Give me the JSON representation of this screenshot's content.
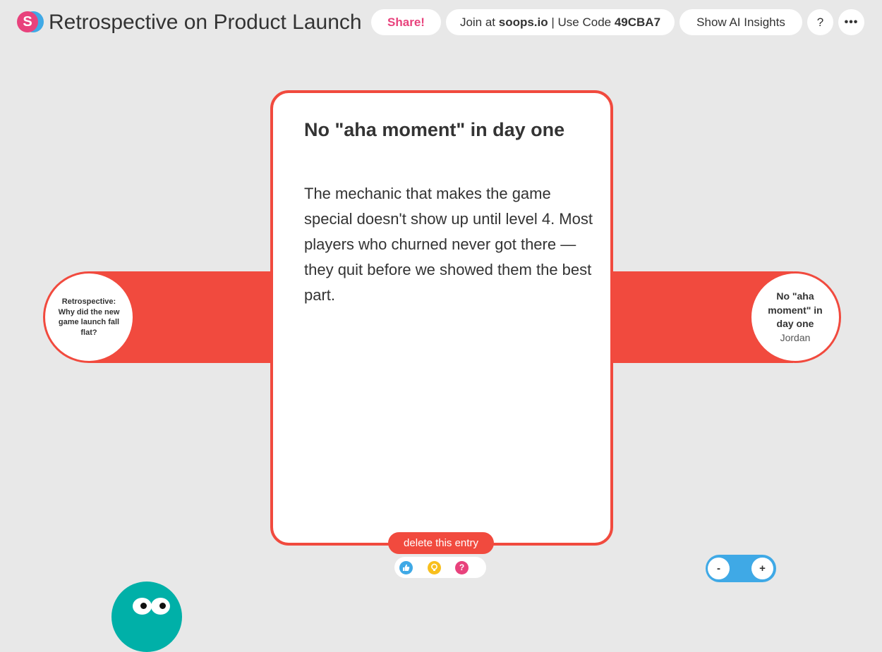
{
  "app": {
    "logo_letter": "S",
    "title": "Retrospective on Product Launch"
  },
  "header": {
    "share_label": "Share!",
    "join_prefix": "Join at ",
    "join_site": "soops.io",
    "join_middle": " | Use Code ",
    "join_code": "49CBA7",
    "insights_label": "Show AI Insights",
    "help_label": "?",
    "more_label": "•••"
  },
  "left_node": {
    "text": "Retrospective: Why did the new game launch fall flat?"
  },
  "right_node": {
    "title": "No \"aha moment\" in day one",
    "author": "Jordan"
  },
  "card": {
    "title": "No \"aha moment\" in day one",
    "body": "The mechanic that makes the game special doesn't show up until level 4. Most players who churned never got there — they quit before we showed them the best part."
  },
  "actions": {
    "delete_label": "delete this entry",
    "reactions": [
      {
        "icon": "thumbs-up-icon",
        "glyph": "👍",
        "color": "#3fa9e6"
      },
      {
        "icon": "lightbulb-icon",
        "glyph": "💡",
        "color": "#f8bf1d"
      },
      {
        "icon": "question-icon",
        "glyph": "?",
        "color": "#e8427c"
      }
    ]
  },
  "zoom": {
    "out_label": "-",
    "in_label": "+"
  },
  "colors": {
    "accent_red": "#f14a3e",
    "brand_pink": "#e8427c",
    "brand_blue": "#3fa9e6",
    "mascot_teal": "#00b0a8",
    "background": "#e8e8e8"
  }
}
